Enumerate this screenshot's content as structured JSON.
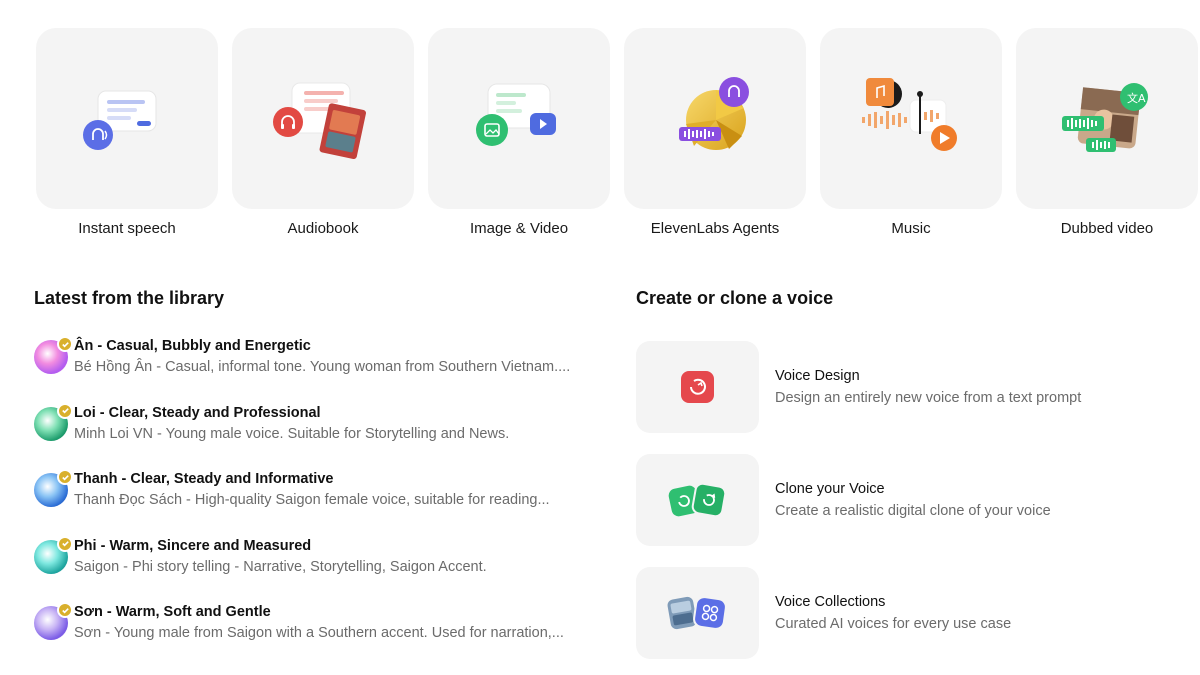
{
  "features": [
    {
      "label": "Instant speech",
      "icon": "instant-speech-icon"
    },
    {
      "label": "Audiobook",
      "icon": "audiobook-icon"
    },
    {
      "label": "Image & Video",
      "icon": "image-video-icon"
    },
    {
      "label": "ElevenLabs Agents",
      "icon": "agents-icon"
    },
    {
      "label": "Music",
      "icon": "music-icon"
    },
    {
      "label": "Dubbed video",
      "icon": "dubbed-video-icon"
    }
  ],
  "library": {
    "title": "Latest from the library",
    "items": [
      {
        "name": "Ân - Casual, Bubbly and Energetic",
        "desc": "Bé Hồng Ân - Casual, informal tone. Young woman from Southern Vietnam...."
      },
      {
        "name": "Loi - Clear, Steady and Professional",
        "desc": "Minh Loi VN - Young male voice. Suitable for Storytelling and News."
      },
      {
        "name": "Thanh - Clear, Steady and Informative",
        "desc": "Thanh Đọc Sách - High-quality Saigon female voice, suitable for reading..."
      },
      {
        "name": "Phi - Warm, Sincere and Measured",
        "desc": "Saigon - Phi story telling - Narrative, Storytelling, Saigon Accent."
      },
      {
        "name": "Sơn - Warm, Soft and Gentle",
        "desc": "Sơn - Young male from Saigon with a Southern accent. Used for narration,..."
      }
    ]
  },
  "create": {
    "title": "Create or clone a voice",
    "items": [
      {
        "title": "Voice Design",
        "desc": "Design an entirely new voice from a text prompt",
        "icon": "voice-design-icon"
      },
      {
        "title": "Clone your Voice",
        "desc": "Create a realistic digital clone of your voice",
        "icon": "clone-voice-icon"
      },
      {
        "title": "Voice Collections",
        "desc": "Curated AI voices for every use case",
        "icon": "voice-collections-icon"
      }
    ]
  },
  "colors": {
    "card_bg": "#f4f4f4",
    "verified_badge": "#d9b02c",
    "voice_design_red": "#e5484d",
    "clone_green": "#2fbf71",
    "collections_blue": "#5b6ee6"
  }
}
